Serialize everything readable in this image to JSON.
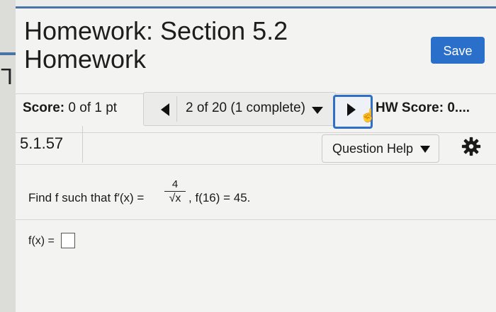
{
  "page": {
    "title_line1": "Homework: Section 5.2",
    "title_line2": "Homework",
    "save_label": "Save"
  },
  "score_bar": {
    "score_label": "Score:",
    "score_value": "0 of 1 pt",
    "nav_label": "2 of 20 (1 complete)",
    "hw_score_label": "HW Score: 0...."
  },
  "question": {
    "id": "5.1.57",
    "help_label": "Question Help",
    "prompt_start": "Find f such that f′(x) =",
    "frac_num": "4",
    "frac_den": "√x",
    "prompt_end": ",  f(16) = 45.",
    "answer_label": "f(x) ="
  },
  "icons": {
    "prev": "left-triangle-icon",
    "next": "right-triangle-icon",
    "cursor": "hand-cursor-icon",
    "settings": "gear-icon",
    "dropdown": "caret-down-icon"
  },
  "colors": {
    "accent": "#2a6fc9",
    "focus_border": "#2f6fc6",
    "top_bar": "#4b74a6"
  }
}
